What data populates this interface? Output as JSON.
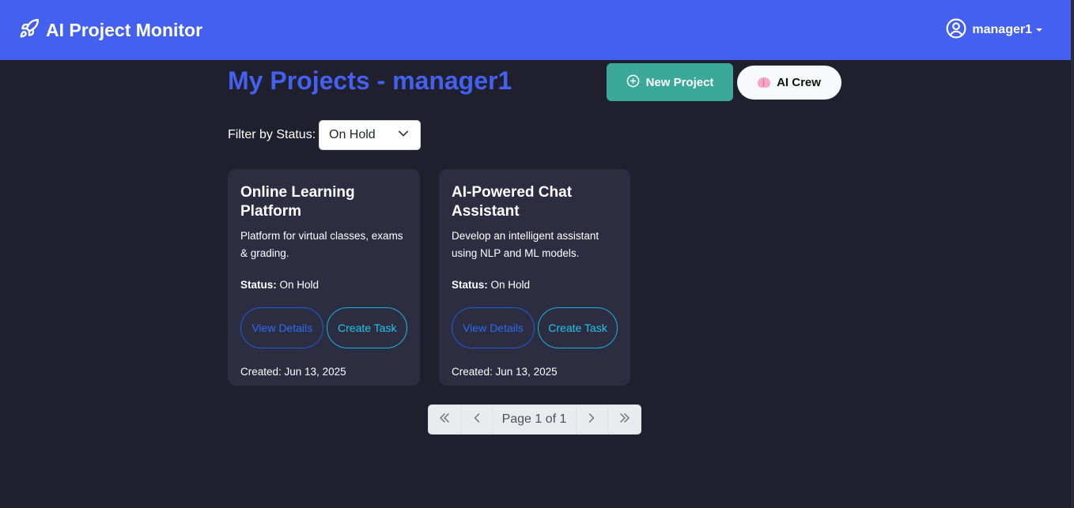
{
  "app": {
    "title": "AI Project Monitor"
  },
  "user": {
    "name": "manager1"
  },
  "header": {
    "page_title": "My Projects - manager1",
    "new_project_label": "New Project",
    "ai_crew_label": "AI Crew"
  },
  "filter": {
    "label": "Filter by Status:",
    "selected": "On Hold"
  },
  "projects": [
    {
      "title": "Online Learning Platform",
      "description": "Platform for virtual classes, exams & grading.",
      "status_label": "Status:",
      "status": "On Hold",
      "view_label": "View Details",
      "task_label": "Create Task",
      "created": "Created: Jun 13, 2025"
    },
    {
      "title": "AI-Powered Chat Assistant",
      "description": "Develop an intelligent assistant using NLP and ML models.",
      "status_label": "Status:",
      "status": "On Hold",
      "view_label": "View Details",
      "task_label": "Create Task",
      "created": "Created: Jun 13, 2025"
    }
  ],
  "pagination": {
    "label": "Page 1 of 1"
  },
  "icons": {
    "brand": "rocket-icon",
    "user": "user-circle-icon",
    "new_project": "plus-circle-icon",
    "ai_crew": "brain-icon",
    "select": "chevron-down-icon",
    "first": "double-chevron-left-icon",
    "prev": "chevron-left-icon",
    "next": "chevron-right-icon",
    "last": "double-chevron-right-icon"
  },
  "colors": {
    "navbar": "#4361ee",
    "background": "#1f1f2e",
    "card": "#2d2d42",
    "title": "#4361ee",
    "new_project_button": "#3aa99a",
    "view_button": "#2d6bf2",
    "task_button": "#22c6ea"
  }
}
